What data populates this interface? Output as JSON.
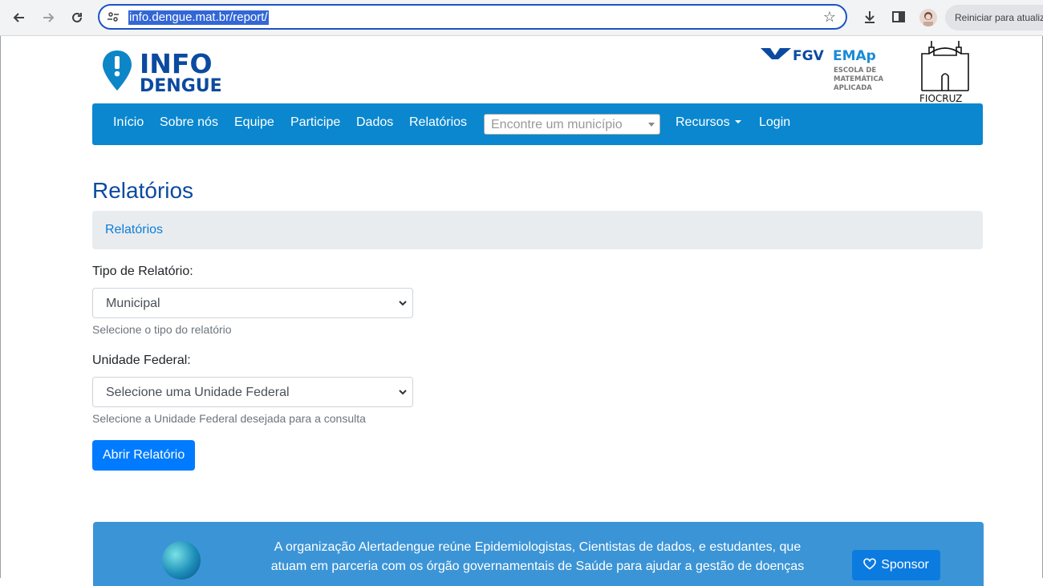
{
  "browser": {
    "url": "info.dengue.mat.br/report/",
    "restart_label": "Reiniciar para atualizar"
  },
  "header": {
    "logo_line1": "INFO",
    "logo_line2": "DENGUE",
    "fgv_text": "FGV",
    "emap_text": "EMAp",
    "emap_sub1": "ESCOLA DE",
    "emap_sub2": "MATEMÁTICA",
    "emap_sub3": "APLICADA",
    "fiocruz_text": "FIOCRUZ"
  },
  "navbar": {
    "items": [
      "Início",
      "Sobre nós",
      "Equipe",
      "Participe",
      "Dados",
      "Relatórios"
    ],
    "search_placeholder": "Encontre um município",
    "resources": "Recursos",
    "login": "Login"
  },
  "main": {
    "title": "Relatórios",
    "breadcrumb": "Relatórios",
    "report_type_label": "Tipo de Relatório:",
    "report_type_value": "Municipal",
    "report_type_help": "Selecione o tipo do relatório",
    "uf_label": "Unidade Federal:",
    "uf_value": "Selecione uma Unidade Federal",
    "uf_help": "Selecione a Unidade Federal desejada para a consulta",
    "open_button": "Abrir Relatório"
  },
  "footer": {
    "text": "A organização Alertadengue reúne Epidemiologistas, Cientistas de dados, e estudantes, que atuam em parceria com os órgão governamentais de Saúde para ajudar a gestão de doenças",
    "sponsor": "Sponsor"
  }
}
